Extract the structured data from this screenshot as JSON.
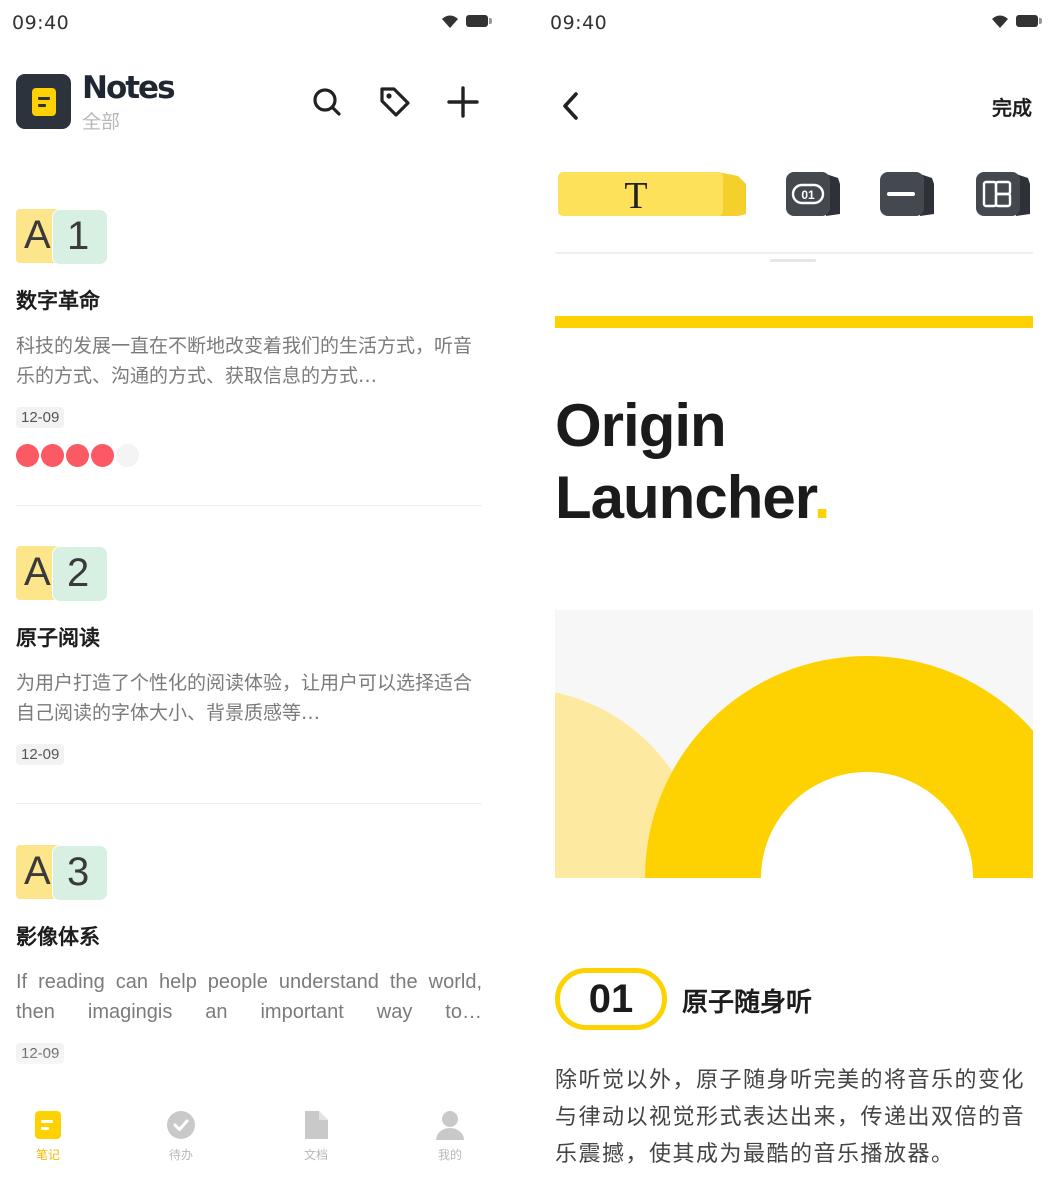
{
  "left_screen": {
    "status": {
      "time": "09:40"
    },
    "header": {
      "title": "Notes",
      "subtitle": "全部",
      "logo_icon": "note-doc-icon",
      "actions": [
        {
          "name": "search",
          "icon": "search-icon"
        },
        {
          "name": "tags",
          "icon": "tag-icon"
        },
        {
          "name": "add",
          "icon": "plus-icon"
        }
      ]
    },
    "notes": [
      {
        "badge_letter": "A",
        "badge_number": "1",
        "title": "数字革命",
        "body": "科技的发展一直在不断地改变着我们的生活方式，听音乐的方式、沟通的方式、获取信息的方式…",
        "date": "12-09",
        "rating": 4,
        "rating_max": 5
      },
      {
        "badge_letter": "A",
        "badge_number": "2",
        "title": "原子阅读",
        "body": "为用户打造了个性化的阅读体验，让用户可以选择适合自己阅读的字体大小、背景质感等…",
        "date": "12-09"
      },
      {
        "badge_letter": "A",
        "badge_number": "3",
        "title": "影像体系",
        "body": "If reading can help people understand the world, then imagingis an important way to…",
        "date": "12-09"
      }
    ],
    "tab_bar": [
      {
        "label": "笔记",
        "icon": "note-icon",
        "active": true
      },
      {
        "label": "待办",
        "icon": "check-circle-icon",
        "active": false
      },
      {
        "label": "文档",
        "icon": "document-icon",
        "active": false
      },
      {
        "label": "我的",
        "icon": "user-icon",
        "active": false
      }
    ],
    "colors": {
      "accent": "#fed201",
      "rating": "#fb5964",
      "badge_letter_bg": "#fde58c",
      "badge_number_bg": "#d8f0e2"
    }
  },
  "right_screen": {
    "status": {
      "time": "09:40"
    },
    "nav": {
      "back_icon": "chevron-left-icon",
      "done_label": "完成"
    },
    "toolbar": [
      {
        "name": "text-block",
        "glyph": "T",
        "selected": true
      },
      {
        "name": "number-block",
        "glyph": "01"
      },
      {
        "name": "divider-block",
        "glyph": "—"
      },
      {
        "name": "layout-block",
        "glyph": "layout"
      }
    ],
    "hero": {
      "line1": "Origin",
      "line2": "Launcher",
      "dot": "."
    },
    "section": {
      "number": "01",
      "title": "原子随身听",
      "body": "除听觉以外，原子随身听完美的将音乐的变化与律动以视觉形式表达出来，传递出双倍的音乐震撼，使其成为最酷的音乐播放器。"
    }
  }
}
